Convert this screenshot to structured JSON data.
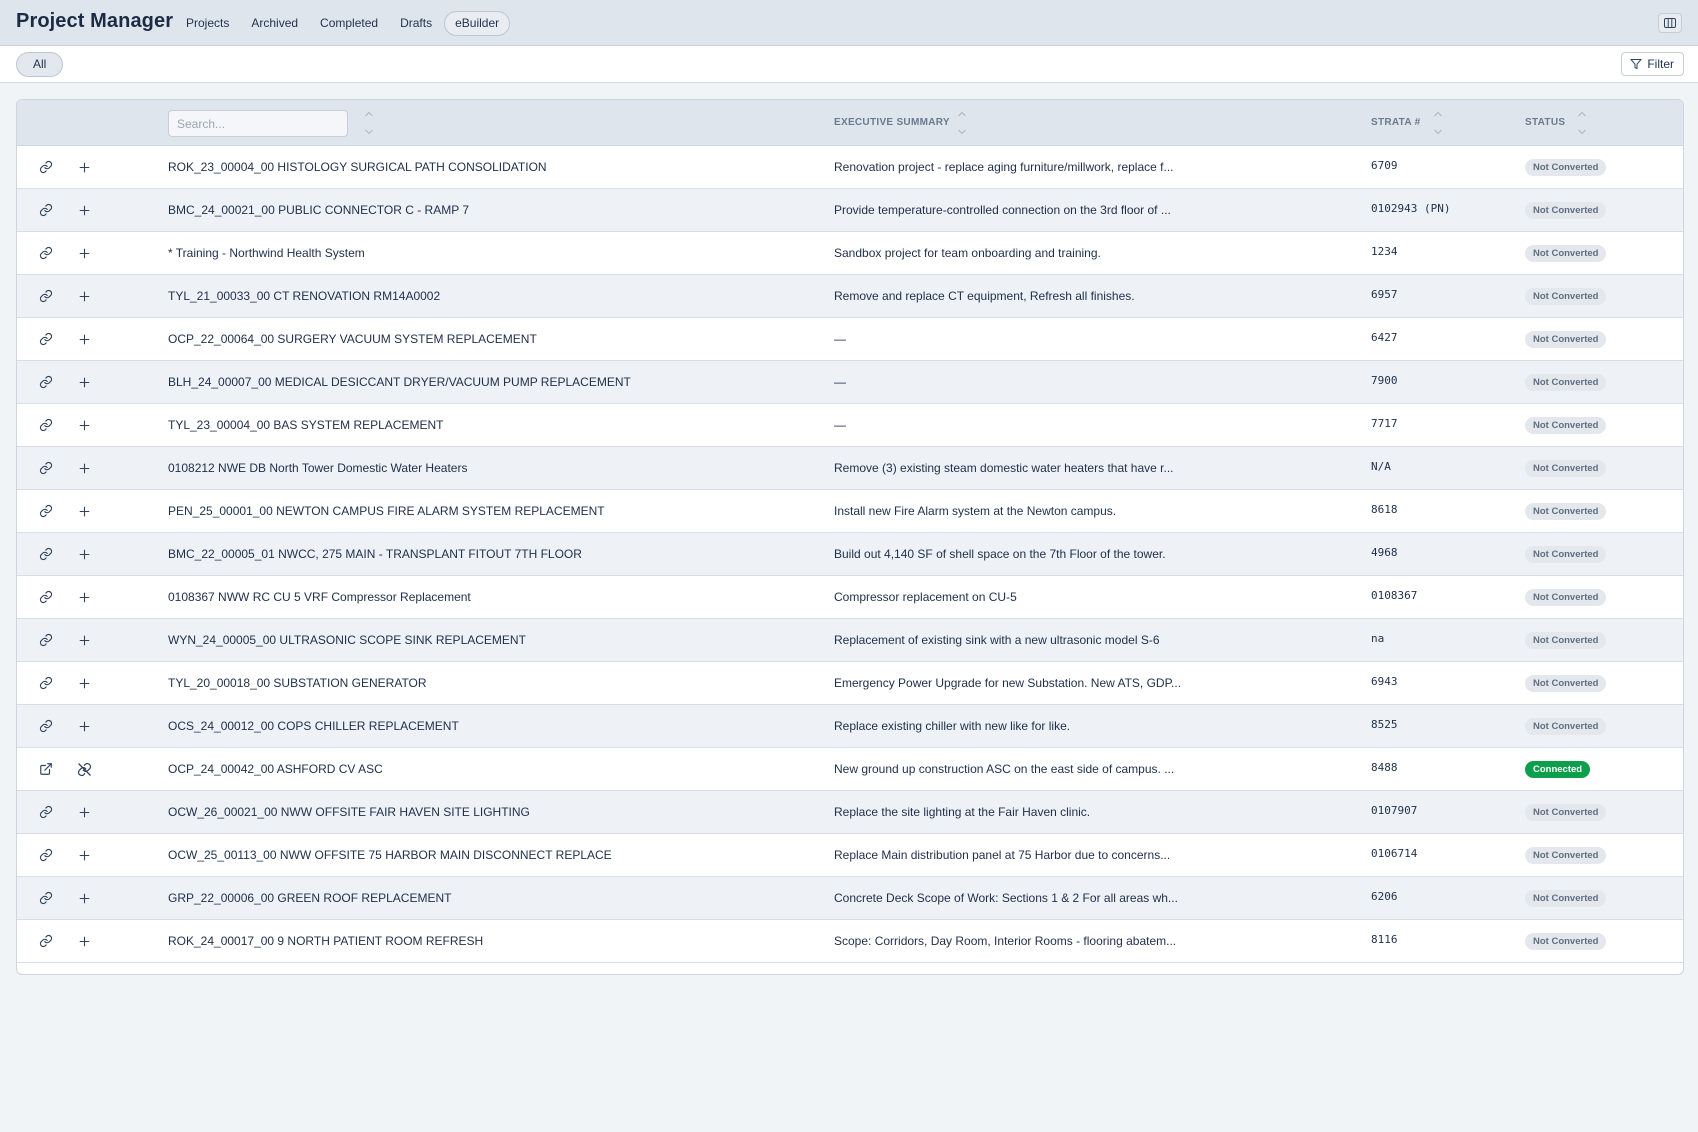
{
  "app": {
    "title": "Project Manager"
  },
  "nav": {
    "tabs": [
      "Projects",
      "Archived",
      "Completed",
      "Drafts",
      "eBuilder"
    ],
    "active": "eBuilder"
  },
  "toolbar": {
    "chip_label": "All",
    "filter_label": "Filter"
  },
  "table": {
    "search_placeholder": "Search...",
    "headers": {
      "summary": "EXECUTIVE SUMMARY",
      "strata": "STRATA #",
      "status": "STATUS"
    },
    "rows": [
      {
        "name": "ROK_23_00004_00 HISTOLOGY SURGICAL PATH CONSOLIDATION",
        "summary": "Renovation project - replace aging furniture/millwork, replace f...",
        "strata": "6709",
        "status": "Not Converted",
        "connected": false
      },
      {
        "name": "BMC_24_00021_00 PUBLIC CONNECTOR C - RAMP 7",
        "summary": "Provide temperature-controlled connection on the 3rd floor of ...",
        "strata": "0102943 (PN)",
        "status": "Not Converted",
        "connected": false
      },
      {
        "name": "* Training - Northwind Health System",
        "summary": "Sandbox project for team onboarding and training.",
        "strata": "1234",
        "status": "Not Converted",
        "connected": false
      },
      {
        "name": "TYL_21_00033_00 CT RENOVATION RM14A0002",
        "summary": "Remove and replace CT equipment, Refresh all finishes.",
        "strata": "6957",
        "status": "Not Converted",
        "connected": false
      },
      {
        "name": "OCP_22_00064_00 SURGERY VACUUM SYSTEM REPLACEMENT",
        "summary": "—",
        "strata": "6427",
        "status": "Not Converted",
        "connected": false
      },
      {
        "name": "BLH_24_00007_00 MEDICAL DESICCANT DRYER/VACUUM PUMP REPLACEMENT",
        "summary": "—",
        "strata": "7900",
        "status": "Not Converted",
        "connected": false
      },
      {
        "name": "TYL_23_00004_00 BAS SYSTEM REPLACEMENT",
        "summary": "—",
        "strata": "7717",
        "status": "Not Converted",
        "connected": false
      },
      {
        "name": "0108212 NWE DB North Tower Domestic Water Heaters",
        "summary": "Remove (3) existing steam domestic water heaters that have r...",
        "strata": "N/A",
        "status": "Not Converted",
        "connected": false
      },
      {
        "name": "PEN_25_00001_00 NEWTON CAMPUS FIRE ALARM SYSTEM REPLACEMENT",
        "summary": "Install new Fire Alarm system at the Newton campus.",
        "strata": "8618",
        "status": "Not Converted",
        "connected": false
      },
      {
        "name": "BMC_22_00005_01 NWCC, 275 MAIN - TRANSPLANT FITOUT 7TH FLOOR",
        "summary": "Build out 4,140 SF of shell space on the 7th Floor of the tower.",
        "strata": "4968",
        "status": "Not Converted",
        "connected": false
      },
      {
        "name": "0108367 NWW RC CU 5 VRF Compressor Replacement",
        "summary": "Compressor replacement on CU-5",
        "strata": "0108367",
        "status": "Not Converted",
        "connected": false
      },
      {
        "name": "WYN_24_00005_00 ULTRASONIC SCOPE SINK REPLACEMENT",
        "summary": "Replacement of existing sink with a new ultrasonic model S-6",
        "strata": "na",
        "status": "Not Converted",
        "connected": false
      },
      {
        "name": "TYL_20_00018_00 SUBSTATION GENERATOR",
        "summary": "Emergency Power Upgrade for new Substation. New ATS, GDP...",
        "strata": "6943",
        "status": "Not Converted",
        "connected": false
      },
      {
        "name": "OCS_24_00012_00 COPS CHILLER REPLACEMENT",
        "summary": "Replace existing chiller with new like for like.",
        "strata": "8525",
        "status": "Not Converted",
        "connected": false
      },
      {
        "name": "OCP_24_00042_00 ASHFORD CV ASC",
        "summary": "New ground up construction ASC on the east side of campus. ...",
        "strata": "8488",
        "status": "Connected",
        "connected": true
      },
      {
        "name": "OCW_26_00021_00 NWW OFFSITE FAIR HAVEN SITE LIGHTING",
        "summary": "Replace the site lighting at the Fair Haven clinic.",
        "strata": "0107907",
        "status": "Not Converted",
        "connected": false
      },
      {
        "name": "OCW_25_00113_00 NWW OFFSITE 75 HARBOR MAIN DISCONNECT REPLACE",
        "summary": "Replace Main distribution panel at 75 Harbor due to concerns...",
        "strata": "0106714",
        "status": "Not Converted",
        "connected": false
      },
      {
        "name": "GRP_22_00006_00 GREEN ROOF REPLACEMENT",
        "summary": "Concrete Deck Scope of Work: Sections 1 & 2 For all areas wh...",
        "strata": "6206",
        "status": "Not Converted",
        "connected": false
      },
      {
        "name": "ROK_24_00017_00 9 NORTH PATIENT ROOM REFRESH",
        "summary": "Scope: Corridors, Day Room, Interior Rooms - flooring abatem...",
        "strata": "8116",
        "status": "Not Converted",
        "connected": false
      }
    ]
  },
  "colors": {
    "connected": "#0e9f4d",
    "header_bg": "#dfe5ec",
    "row_alt": "#eef1f5"
  },
  "icons": {
    "row_link": "link-icon",
    "row_add": "plus-icon",
    "row_open": "external-link-icon",
    "row_unlink": "unlink-icon"
  }
}
